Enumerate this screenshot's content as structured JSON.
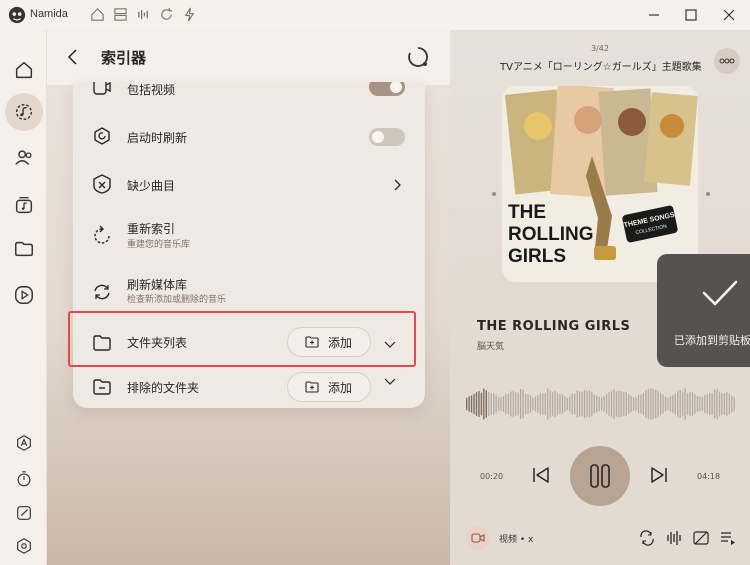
{
  "app": {
    "name": "Namida"
  },
  "titlebar_icons": [
    "home-icon",
    "layers-icon",
    "equalizer-icon",
    "refresh-icon",
    "lightning-icon"
  ],
  "window_controls": [
    "minimize-icon",
    "maximize-icon",
    "close-icon"
  ],
  "nav": {
    "items": [
      "home-icon",
      "indexer-icon",
      "users-icon",
      "music-library-icon",
      "folder-icon",
      "play-circle-icon"
    ],
    "active": "indexer-icon",
    "bottom": [
      "translate-icon",
      "timer-icon",
      "edit-icon",
      "settings-icon"
    ]
  },
  "page": {
    "title": "索引器"
  },
  "settings": {
    "rows": [
      {
        "label": "包括视频",
        "icon": "video-icon",
        "control": "toggle",
        "on": true
      },
      {
        "label": "启动时刷新",
        "icon": "refresh-settings-icon",
        "control": "toggle",
        "on": false
      },
      {
        "label": "缺少曲目",
        "icon": "missing-icon",
        "control": "chevron"
      },
      {
        "label": "重新索引",
        "sub": "重建您的音乐库",
        "icon": "reindex-icon"
      },
      {
        "label": "刷新媒体库",
        "sub": "检查新添加或删除的音乐",
        "icon": "refresh-library-icon"
      },
      {
        "label": "文件夹列表",
        "icon": "folder-icon",
        "control": "add",
        "button": "添加"
      },
      {
        "label": "排除的文件夹",
        "icon": "folder-minus-icon",
        "control": "add",
        "button": "添加"
      }
    ]
  },
  "player": {
    "track_count": "3/42",
    "album": "TVアニメ「ローリング☆ガールズ」主題歌集",
    "song_title": "THE ROLLING GIRLS",
    "artist": "脳天気",
    "time_current": "00:20",
    "time_total": "04:18",
    "progress": 0.078,
    "video_label": "视频 • x",
    "cover_text": {
      "line1": "THE",
      "line2": "ROLLING",
      "line3": "GIRLS",
      "badge": "THEME SONGS",
      "badge_sub": "COLLECTION"
    }
  },
  "toast": {
    "text": "已添加到剪贴板"
  },
  "colors": {
    "highlight": "#e5484d",
    "accent": "#b9a494"
  }
}
